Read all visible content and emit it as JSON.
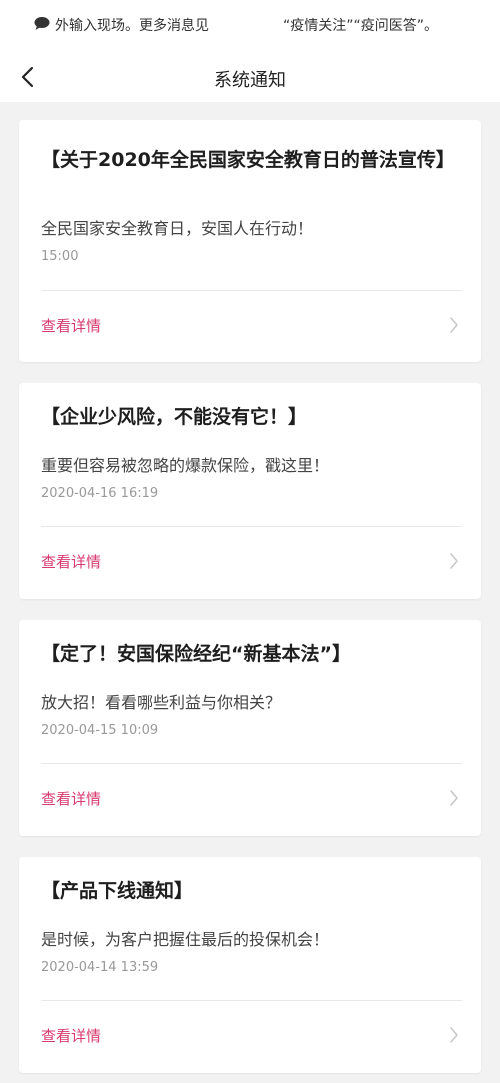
{
  "ticker": {
    "icon": "message-bubble-icon",
    "left_text": "外输入现场。更多消息见",
    "right_text": "“疫情关注”“疫问医答”。"
  },
  "navbar": {
    "back_icon": "chevron-left-icon",
    "title": "系统通知"
  },
  "accent_color": "#d73a6d",
  "notices": [
    {
      "title": "【关于2020年全民国家安全教育日的普法宣传】",
      "subtitle": "全民国家安全教育日，安国人在行动！",
      "time": "15:00",
      "link": "查看详情"
    },
    {
      "title": "【企业少风险，不能没有它！】",
      "subtitle": "重要但容易被忽略的爆款保险，戳这里！",
      "time": "2020-04-16 16:19",
      "link": "查看详情"
    },
    {
      "title": "【定了！安国保险经纪“新基本法”】",
      "subtitle": "放大招！看看哪些利益与你相关？",
      "time": "2020-04-15 10:09",
      "link": "查看详情"
    },
    {
      "title": "【产品下线通知】",
      "subtitle": "是时候，为客户把握住最后的投保机会！",
      "time": "2020-04-14 13:59",
      "link": "查看详情"
    }
  ]
}
